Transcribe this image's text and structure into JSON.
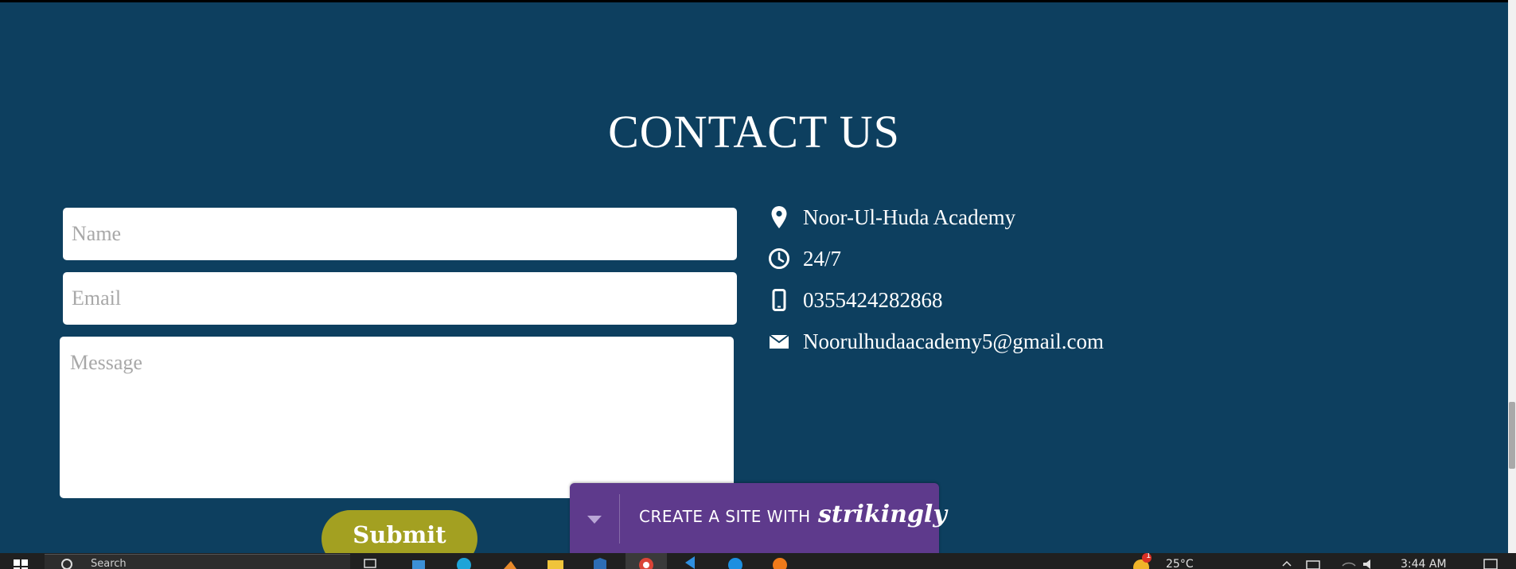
{
  "section": {
    "title": "CONTACT US"
  },
  "form": {
    "name_placeholder": "Name",
    "email_placeholder": "Email",
    "message_placeholder": "Message",
    "submit_label": "Submit"
  },
  "contact_info": {
    "items": [
      {
        "icon": "location-pin-icon",
        "text": "Noor-Ul-Huda Academy"
      },
      {
        "icon": "clock-icon",
        "text": "24/7"
      },
      {
        "icon": "mobile-phone-icon",
        "text": "0355424282868"
      },
      {
        "icon": "envelope-icon",
        "text": "Noorulhudaacademy5@gmail.com"
      }
    ]
  },
  "banner": {
    "text": "CREATE A SITE WITH",
    "brand": "strikingly"
  },
  "taskbar": {
    "search_text": "Search",
    "weather": "25°C",
    "notification_count": "1",
    "time": "3:44 AM"
  },
  "colors": {
    "section_background": "#0d3f5f",
    "submit_button": "#a3a021",
    "banner_background": "#5e3a8c",
    "taskbar": "#202020"
  }
}
